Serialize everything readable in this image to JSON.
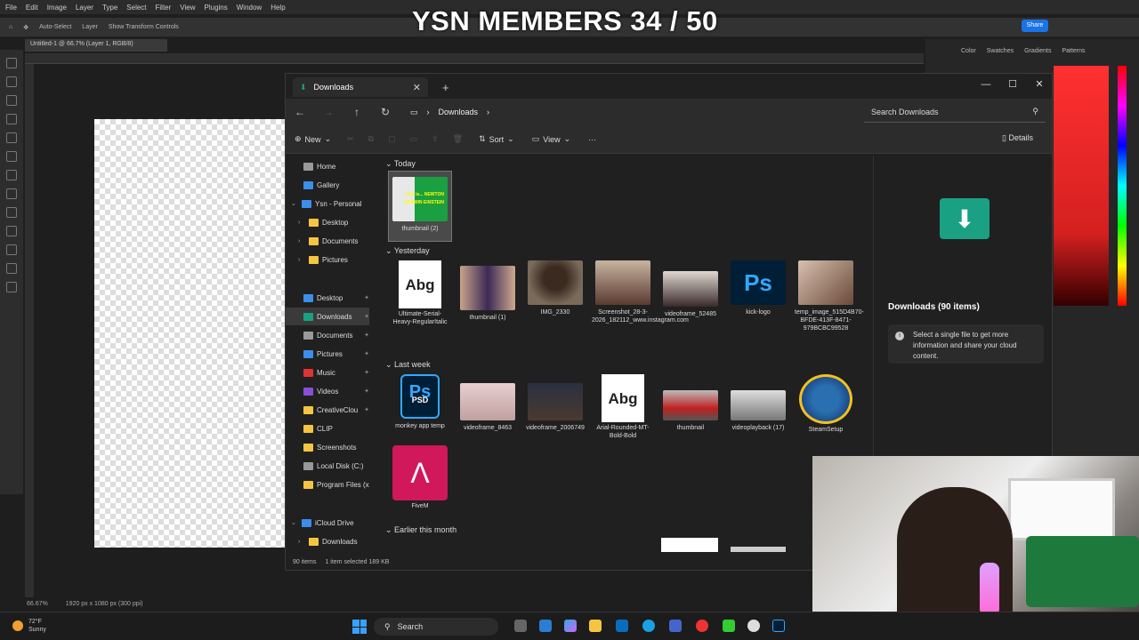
{
  "overlay": {
    "title": "YSN MEMBERS 34 / 50"
  },
  "photoshop": {
    "menu": [
      "File",
      "Edit",
      "Image",
      "Layer",
      "Type",
      "Select",
      "Filter",
      "View",
      "Plugins",
      "Window",
      "Help"
    ],
    "options": {
      "auto_select": "Auto-Select",
      "layer": "Layer",
      "transform": "Show Transform Controls"
    },
    "doc_tab": "Untitled-1 @ 66.7% (Layer 1, RGB/8)",
    "share": "Share",
    "panel_tabs": [
      "Color",
      "Swatches",
      "Gradients",
      "Patterns"
    ],
    "zoom": "66.67%",
    "doc_size": "1920 px x 1080 px (300 ppi)"
  },
  "explorer": {
    "tab_title": "Downloads",
    "breadcrumb": "Downloads",
    "search_placeholder": "Search Downloads",
    "toolbar": {
      "new": "New",
      "sort": "Sort",
      "view": "View",
      "more": "···",
      "details": "Details"
    },
    "nav": [
      {
        "label": "Home",
        "kind": "home"
      },
      {
        "label": "Gallery",
        "kind": "gallery"
      },
      {
        "label": "Ysn - Personal",
        "kind": "cloud"
      },
      {
        "label": "Desktop",
        "kind": "folder"
      },
      {
        "label": "Documents",
        "kind": "folder"
      },
      {
        "label": "Pictures",
        "kind": "folder"
      },
      {
        "label": "Desktop",
        "kind": "blue"
      },
      {
        "label": "Downloads",
        "kind": "green"
      },
      {
        "label": "Documents",
        "kind": "gray"
      },
      {
        "label": "Pictures",
        "kind": "blue"
      },
      {
        "label": "Music",
        "kind": "red"
      },
      {
        "label": "Videos",
        "kind": "blue"
      },
      {
        "label": "CreativeClou",
        "kind": "folder"
      },
      {
        "label": "CLIP",
        "kind": "folder"
      },
      {
        "label": "Screenshots",
        "kind": "folder"
      },
      {
        "label": "Local Disk (C:)",
        "kind": "gray"
      },
      {
        "label": "Program Files (x",
        "kind": "folder"
      },
      {
        "label": "iCloud Drive",
        "kind": "blue"
      },
      {
        "label": "Downloads",
        "kind": "folder"
      }
    ],
    "groups": {
      "today": "Today",
      "yesterday": "Yesterday",
      "last_week": "Last week",
      "earlier": "Earlier this month"
    },
    "files": {
      "today": [
        {
          "name": "thumbnail (2)"
        }
      ],
      "yesterday": [
        {
          "name": "Ultimate-Serial-Heavy-RegularItalic"
        },
        {
          "name": "thumbnail (1)"
        },
        {
          "name": "IMG_2330"
        },
        {
          "name": "Screenshot_28-3-2026_182112_www.instagram.com"
        },
        {
          "name": "videoframe_52485"
        },
        {
          "name": "kick-logo"
        },
        {
          "name": "temp_image_515D4B70-BFDE-413F-8471-979BCBC99528"
        }
      ],
      "last_week": [
        {
          "name": "monkey app temp"
        },
        {
          "name": "videoframe_8463"
        },
        {
          "name": "videoframe_2006749"
        },
        {
          "name": "Arial-Rounded-MT-Bold-Bold"
        },
        {
          "name": "thumbnail"
        },
        {
          "name": "videoplayback (17)"
        },
        {
          "name": "SteamSetup"
        },
        {
          "name": "FiveM"
        }
      ]
    },
    "icon_text": {
      "font_sample": "Abg",
      "ps": "Ps",
      "psd": "PSD",
      "fivem_glyph": "Λ",
      "thumb_caption": "This is... NEWTON DARWIN EINSTEIN"
    },
    "details": {
      "title": "Downloads (90 items)",
      "info": "Select a single file to get more information and share your cloud content."
    },
    "status": {
      "count": "90 items",
      "selected": "1 item selected  189 KB"
    }
  },
  "taskbar": {
    "temp": "72°F",
    "weather": "Sunny",
    "search": "Search"
  },
  "colors": {
    "accent": "#1a73e8",
    "ps_blue": "#31a8ff",
    "downloads_green": "#1aa083"
  }
}
